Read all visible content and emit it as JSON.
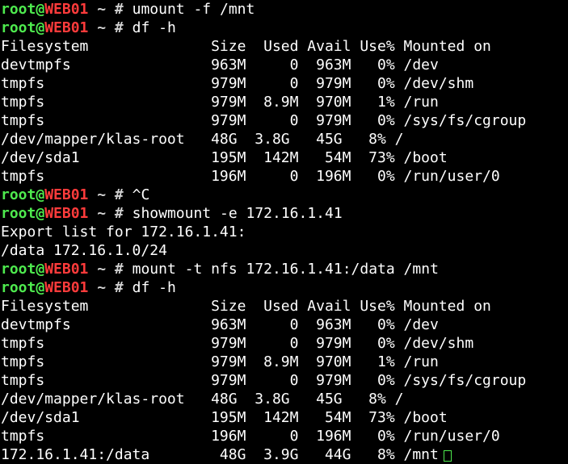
{
  "prompt": {
    "user": "root",
    "at": "@",
    "host": "WEB01",
    "path": "~",
    "symbol": "#"
  },
  "colors": {
    "background": "#000000",
    "user": "#4eea4e",
    "host": "#ff3b3b",
    "text": "#ffffff"
  },
  "lines": [
    {
      "type": "prompt",
      "cmd": "umount -f /mnt"
    },
    {
      "type": "prompt",
      "cmd": "df -h"
    },
    {
      "type": "output",
      "text": "Filesystem              Size  Used Avail Use% Mounted on"
    },
    {
      "type": "output",
      "text": "devtmpfs                963M     0  963M   0% /dev"
    },
    {
      "type": "output",
      "text": "tmpfs                   979M     0  979M   0% /dev/shm"
    },
    {
      "type": "output",
      "text": "tmpfs                   979M  8.9M  970M   1% /run"
    },
    {
      "type": "output",
      "text": "tmpfs                   979M     0  979M   0% /sys/fs/cgroup"
    },
    {
      "type": "output",
      "text": "/dev/mapper/klas-root   48G  3.8G   45G   8% /"
    },
    {
      "type": "output",
      "text": "/dev/sda1               195M  142M   54M  73% /boot"
    },
    {
      "type": "output",
      "text": "tmpfs                   196M     0  196M   0% /run/user/0"
    },
    {
      "type": "prompt",
      "cmd": "^C"
    },
    {
      "type": "prompt",
      "cmd": "showmount -e 172.16.1.41"
    },
    {
      "type": "output",
      "text": "Export list for 172.16.1.41:"
    },
    {
      "type": "output",
      "text": "/data 172.16.1.0/24"
    },
    {
      "type": "prompt",
      "cmd": "mount -t nfs 172.16.1.41:/data /mnt"
    },
    {
      "type": "prompt",
      "cmd": "df -h"
    },
    {
      "type": "output",
      "text": "Filesystem              Size  Used Avail Use% Mounted on"
    },
    {
      "type": "output",
      "text": "devtmpfs                963M     0  963M   0% /dev"
    },
    {
      "type": "output",
      "text": "tmpfs                   979M     0  979M   0% /dev/shm"
    },
    {
      "type": "output",
      "text": "tmpfs                   979M  8.9M  970M   1% /run"
    },
    {
      "type": "output",
      "text": "tmpfs                   979M     0  979M   0% /sys/fs/cgroup"
    },
    {
      "type": "output",
      "text": "/dev/mapper/klas-root   48G  3.8G   45G   8% /"
    },
    {
      "type": "output",
      "text": "/dev/sda1               195M  142M   54M  73% /boot"
    },
    {
      "type": "output",
      "text": "tmpfs                   196M     0  196M   0% /run/user/0"
    },
    {
      "type": "output",
      "text": "172.16.1.41:/data        48G  3.9G   44G   8% /mnt",
      "cursor": true
    }
  ]
}
